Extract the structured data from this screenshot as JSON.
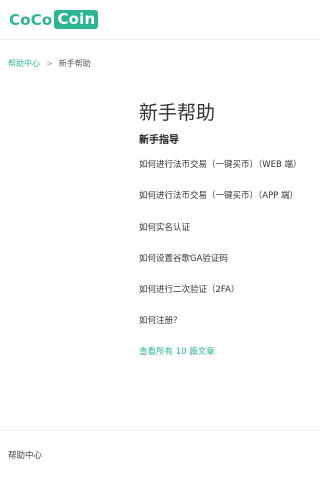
{
  "header": {
    "logo": {
      "part1": "CoCo",
      "part2": "Coin"
    }
  },
  "breadcrumb": {
    "home": "帮助中心",
    "separator": ">",
    "current": "新手帮助"
  },
  "main": {
    "title": "新手帮助",
    "section_title": "新手指导",
    "articles": [
      "如何进行法币交易（一键买币）（WEB 端）",
      "如何进行法币交易（一键买币）（APP 端）",
      "如何实名认证",
      "如何设置谷歌GA验证码",
      "如何进行二次验证（2FA）",
      "如何注册？"
    ],
    "view_all": "查看所有 10 篇文章"
  },
  "footer": {
    "label": "帮助中心"
  },
  "colors": {
    "accent": "#2bb593"
  }
}
